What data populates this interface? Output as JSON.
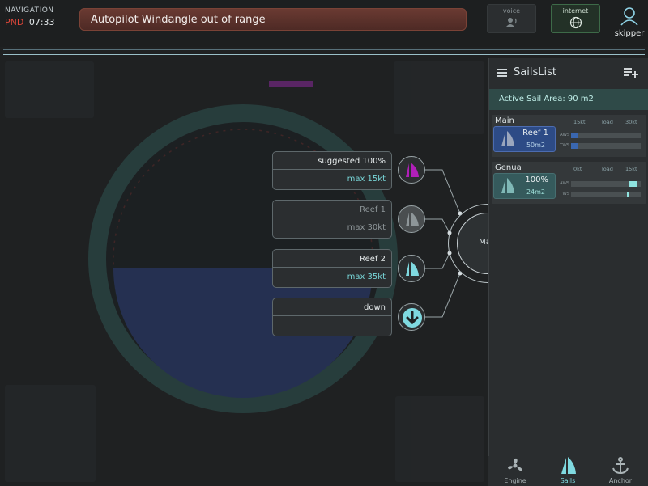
{
  "header": {
    "nav_title": "NAVIGATION",
    "nav_mode": "PND",
    "time": "07:33",
    "alert_text": "Autopilot Windangle out of range",
    "voice_label": "voice",
    "internet_label": "internet",
    "user_label": "skipper"
  },
  "popup": {
    "center_label": "Main",
    "options": [
      {
        "line1": "suggested 100%",
        "line2": "max 15kt",
        "icon": "sail-icon",
        "state": "suggested"
      },
      {
        "line1": "Reef 1",
        "line2": "max 30kt",
        "icon": "sail-icon",
        "state": "current"
      },
      {
        "line1": "Reef 2",
        "line2": "max 35kt",
        "icon": "sail-icon",
        "state": "available"
      },
      {
        "line1": "down",
        "line2": "",
        "icon": "arrow-down-icon",
        "state": "available"
      }
    ]
  },
  "sails_panel": {
    "title": "SailsList",
    "active_area": "Active Sail Area: 90 m2",
    "sails": [
      {
        "name": "Main",
        "hdr_left": "15kt",
        "hdr_mid": "load",
        "hdr_right": "30kt",
        "setting": "Reef 1",
        "area": "50m2",
        "aws_label": "AWS",
        "tws_label": "TWS",
        "aws": 0.1,
        "tws": 0.1
      },
      {
        "name": "Genua",
        "hdr_left": "0kt",
        "hdr_mid": "load",
        "hdr_right": "15kt",
        "setting": "100%",
        "area": "24m2",
        "aws_label": "AWS",
        "tws_label": "TWS",
        "aws": 0.9,
        "tws": 0.82
      }
    ]
  },
  "bottom_nav": {
    "engine": "Engine",
    "sails": "Sails",
    "anchor": "Anchor"
  },
  "colors": {
    "accent": "#78d6d8",
    "alert": "#5e332d",
    "suggested": "#b01fb8",
    "main_tile": "#2d4b86"
  }
}
